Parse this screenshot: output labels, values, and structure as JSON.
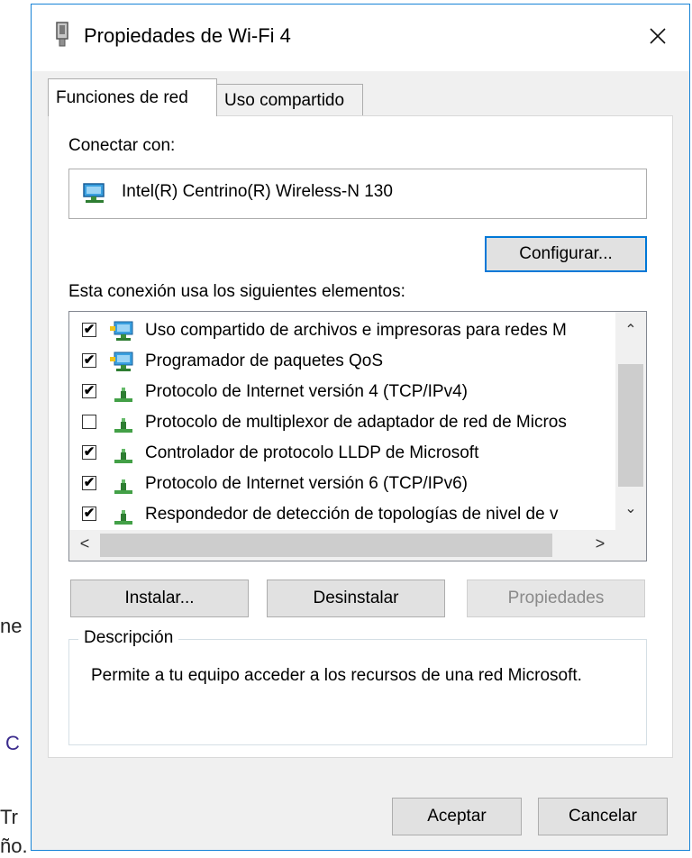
{
  "background": {
    "fragments": [
      "ne",
      "C",
      "Tr",
      "ño."
    ]
  },
  "dialog": {
    "title": "Propiedades de Wi-Fi 4",
    "close_glyph": "✕"
  },
  "tabs": [
    {
      "label": "Funciones de red",
      "active": true
    },
    {
      "label": "Uso compartido",
      "active": false
    }
  ],
  "connect": {
    "label": "Conectar con:",
    "adapter": "Intel(R) Centrino(R) Wireless-N 130",
    "configure_label": "Configurar..."
  },
  "items_label": "Esta conexión usa los siguientes elementos:",
  "items": [
    {
      "label": "Uso compartido de archivos e impresoras para redes M",
      "checked": true,
      "icon": "network-client-icon"
    },
    {
      "label": "Programador de paquetes QoS",
      "checked": true,
      "icon": "network-client-icon"
    },
    {
      "label": "Protocolo de Internet versión 4 (TCP/IPv4)",
      "checked": true,
      "icon": "protocol-icon"
    },
    {
      "label": "Protocolo de multiplexor de adaptador de red de Micros",
      "checked": false,
      "icon": "protocol-icon"
    },
    {
      "label": "Controlador de protocolo LLDP de Microsoft",
      "checked": true,
      "icon": "protocol-icon"
    },
    {
      "label": "Protocolo de Internet versión 6 (TCP/IPv6)",
      "checked": true,
      "icon": "protocol-icon"
    },
    {
      "label": "Respondedor de detección de topologías de nivel de v",
      "checked": true,
      "icon": "protocol-icon"
    }
  ],
  "scroll_glyphs": {
    "up": "⌃",
    "down": "⌄",
    "left": "<",
    "right": ">"
  },
  "buttons": {
    "install": "Instalar...",
    "uninstall": "Desinstalar",
    "properties": "Propiedades",
    "ok": "Aceptar",
    "cancel": "Cancelar"
  },
  "description": {
    "legend": "Descripción",
    "text": "Permite a tu equipo acceder a los recursos de una red Microsoft."
  },
  "colors": {
    "accent": "#0078d7",
    "border": "#1783d6",
    "title_bg": "#ffffff",
    "dialog_bg": "#f0f0f0"
  }
}
